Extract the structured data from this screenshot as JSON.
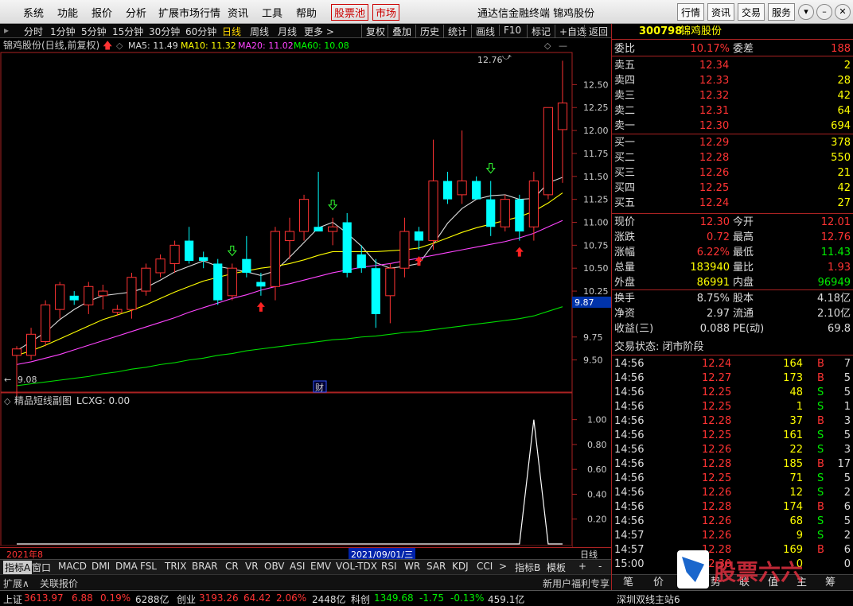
{
  "menubar": {
    "items": [
      "系统",
      "功能",
      "报价",
      "分析",
      "扩展市场行情",
      "资讯",
      "工具",
      "帮助"
    ],
    "highlight": [
      "股票池",
      "市场"
    ],
    "title": "通达信金融终端  锦鸡股份",
    "right_buttons": [
      "行情",
      "资讯",
      "交易",
      "服务"
    ]
  },
  "period": {
    "items": [
      "分时",
      "1分钟",
      "5分钟",
      "15分钟",
      "30分钟",
      "60分钟",
      "日线",
      "周线",
      "月线",
      "更多 >"
    ],
    "active": "日线",
    "tools": [
      "复权",
      "叠加",
      "历史",
      "统计",
      "画线",
      "F10",
      "标记",
      "+自选",
      "返回"
    ]
  },
  "main_chart": {
    "header": {
      "title": "锦鸡股份(日线,前复权)",
      "ma5": "MA5: 11.49",
      "ma10": "MA10: 11.32",
      "ma20": "MA20: 11.02",
      "ma60": "MA60: 10.08"
    },
    "high_label": "12.76",
    "low_label": "9.08",
    "last_tag": "9.87",
    "fin_mark": "财",
    "y_ticks": [
      "12.50",
      "12.25",
      "12.00",
      "11.75",
      "11.50",
      "11.25",
      "11.00",
      "10.75",
      "10.50",
      "10.25",
      "9.75",
      "9.50"
    ]
  },
  "indicator": {
    "title": "精品短线副图",
    "value": "LCXG: 0.00",
    "y_ticks": [
      "1.00",
      "0.80",
      "0.60",
      "0.40",
      "0.20"
    ]
  },
  "timeline": {
    "start": "2021年8",
    "cursor": "2021/09/01/三",
    "period_label": "日线"
  },
  "chart_data": [
    {
      "type": "candlestick",
      "title": "锦鸡股份(日线,前复权)",
      "ylim": [
        9.15,
        12.85
      ],
      "candles": [
        {
          "o": 9.55,
          "h": 9.65,
          "l": 9.1,
          "c": 9.62
        },
        {
          "o": 9.55,
          "h": 9.85,
          "l": 9.5,
          "c": 9.78
        },
        {
          "o": 9.7,
          "h": 10.15,
          "l": 9.65,
          "c": 10.1
        },
        {
          "o": 10.05,
          "h": 10.35,
          "l": 9.95,
          "c": 10.32
        },
        {
          "o": 10.2,
          "h": 10.25,
          "l": 10.1,
          "c": 10.15
        },
        {
          "o": 10.1,
          "h": 10.35,
          "l": 10.0,
          "c": 10.3
        },
        {
          "o": 10.2,
          "h": 10.32,
          "l": 10.05,
          "c": 10.25
        },
        {
          "o": 10.02,
          "h": 10.1,
          "l": 9.98,
          "c": 10.05
        },
        {
          "o": 10.05,
          "h": 10.45,
          "l": 9.95,
          "c": 10.4
        },
        {
          "o": 10.25,
          "h": 10.55,
          "l": 10.2,
          "c": 10.5
        },
        {
          "o": 10.45,
          "h": 10.65,
          "l": 10.4,
          "c": 10.6
        },
        {
          "o": 10.55,
          "h": 10.8,
          "l": 10.45,
          "c": 10.75
        },
        {
          "o": 10.8,
          "h": 10.95,
          "l": 10.55,
          "c": 10.58
        },
        {
          "o": 10.62,
          "h": 10.68,
          "l": 10.5,
          "c": 10.58
        },
        {
          "o": 10.55,
          "h": 10.6,
          "l": 10.1,
          "c": 10.15
        },
        {
          "o": 10.2,
          "h": 10.55,
          "l": 10.15,
          "c": 10.5
        },
        {
          "o": 10.6,
          "h": 10.85,
          "l": 10.4,
          "c": 10.45
        },
        {
          "o": 10.35,
          "h": 10.45,
          "l": 10.2,
          "c": 10.3
        },
        {
          "o": 10.3,
          "h": 10.95,
          "l": 10.15,
          "c": 10.9
        },
        {
          "o": 10.8,
          "h": 11.05,
          "l": 10.6,
          "c": 10.9
        },
        {
          "o": 10.9,
          "h": 11.3,
          "l": 10.8,
          "c": 11.25
        },
        {
          "o": 10.95,
          "h": 11.55,
          "l": 10.9,
          "c": 10.9
        },
        {
          "o": 10.9,
          "h": 11.05,
          "l": 10.75,
          "c": 10.95
        },
        {
          "o": 11.0,
          "h": 11.1,
          "l": 10.4,
          "c": 10.45
        },
        {
          "o": 10.65,
          "h": 10.75,
          "l": 10.45,
          "c": 10.5
        },
        {
          "o": 10.5,
          "h": 10.6,
          "l": 9.85,
          "c": 10.0
        },
        {
          "o": 10.2,
          "h": 10.55,
          "l": 9.9,
          "c": 10.5
        },
        {
          "o": 10.5,
          "h": 11.05,
          "l": 10.4,
          "c": 10.9
        },
        {
          "o": 10.9,
          "h": 10.95,
          "l": 10.7,
          "c": 10.8
        },
        {
          "o": 10.8,
          "h": 11.9,
          "l": 10.7,
          "c": 11.45
        },
        {
          "o": 11.45,
          "h": 11.55,
          "l": 11.2,
          "c": 11.25
        },
        {
          "o": 11.3,
          "h": 12.0,
          "l": 11.2,
          "c": 11.45
        },
        {
          "o": 11.45,
          "h": 11.5,
          "l": 11.25,
          "c": 11.25
        },
        {
          "o": 11.25,
          "h": 11.45,
          "l": 10.85,
          "c": 10.95
        },
        {
          "o": 10.95,
          "h": 11.3,
          "l": 10.9,
          "c": 11.25
        },
        {
          "o": 11.25,
          "h": 11.3,
          "l": 10.8,
          "c": 10.9
        },
        {
          "o": 10.95,
          "h": 11.55,
          "l": 10.8,
          "c": 11.45
        },
        {
          "o": 11.3,
          "h": 12.25,
          "l": 11.25,
          "c": 12.25
        },
        {
          "o": 12.01,
          "h": 12.76,
          "l": 11.43,
          "c": 12.3
        }
      ],
      "ma5": [
        9.6,
        9.7,
        9.8,
        9.94,
        10.05,
        10.14,
        10.2,
        10.22,
        10.24,
        10.29,
        10.37,
        10.46,
        10.52,
        10.58,
        10.52,
        10.49,
        10.46,
        10.42,
        10.47,
        10.62,
        10.78,
        10.94,
        11.0,
        10.88,
        10.74,
        10.56,
        10.5,
        10.52,
        10.55,
        10.76,
        10.99,
        11.15,
        11.25,
        11.29,
        11.3,
        11.25,
        11.26,
        11.43,
        11.49
      ],
      "ma10": [
        9.55,
        9.6,
        9.66,
        9.73,
        9.8,
        9.87,
        9.94,
        9.99,
        10.04,
        10.1,
        10.17,
        10.24,
        10.3,
        10.36,
        10.4,
        10.44,
        10.47,
        10.5,
        10.52,
        10.55,
        10.59,
        10.64,
        10.68,
        10.68,
        10.68,
        10.68,
        10.69,
        10.7,
        10.72,
        10.77,
        10.83,
        10.89,
        10.94,
        10.98,
        11.02,
        11.06,
        11.12,
        11.21,
        11.32
      ],
      "ma20": [
        9.45,
        9.48,
        9.52,
        9.56,
        9.61,
        9.66,
        9.71,
        9.76,
        9.81,
        9.86,
        9.91,
        9.96,
        10.02,
        10.07,
        10.12,
        10.17,
        10.21,
        10.26,
        10.3,
        10.33,
        10.37,
        10.41,
        10.45,
        10.48,
        10.51,
        10.53,
        10.55,
        10.58,
        10.61,
        10.64,
        10.67,
        10.7,
        10.73,
        10.76,
        10.79,
        10.83,
        10.88,
        10.95,
        11.02
      ],
      "ma60": [
        9.22,
        9.24,
        9.26,
        9.28,
        9.3,
        9.32,
        9.35,
        9.37,
        9.4,
        9.42,
        9.45,
        9.47,
        9.5,
        9.52,
        9.55,
        9.57,
        9.6,
        9.62,
        9.64,
        9.66,
        9.68,
        9.7,
        9.72,
        9.73,
        9.75,
        9.76,
        9.78,
        9.8,
        9.81,
        9.83,
        9.85,
        9.87,
        9.89,
        9.91,
        9.93,
        9.95,
        9.98,
        10.03,
        10.08
      ],
      "buy_signals": [
        17,
        28,
        35
      ],
      "sell_signals": [
        15,
        22,
        33
      ]
    },
    {
      "type": "line",
      "title": "精品短线副图",
      "ylim": [
        0,
        1.1
      ],
      "x": [
        0,
        1,
        2,
        3,
        4,
        5,
        6,
        7,
        8,
        9,
        10,
        11,
        12,
        13,
        14,
        15,
        16,
        17,
        18,
        19,
        20,
        21,
        22,
        23,
        24,
        25,
        26,
        27,
        28,
        29,
        30,
        31,
        32,
        33,
        34,
        35,
        36,
        37,
        38
      ],
      "values": [
        0,
        0,
        0,
        0,
        0,
        0,
        0,
        0,
        0,
        0,
        0,
        0,
        0,
        0,
        0,
        0,
        0,
        0,
        0,
        0,
        0,
        0,
        0,
        0,
        0,
        0,
        0,
        0,
        0,
        0,
        0,
        0,
        0,
        0,
        0,
        0,
        1,
        0,
        0
      ]
    }
  ],
  "quote": {
    "code": "300798",
    "name": "锦鸡股份",
    "weibi": {
      "label": "委比",
      "value": "10.17%",
      "label2": "委差",
      "value2": "188"
    },
    "asks": [
      [
        "卖五",
        "12.34",
        "2"
      ],
      [
        "卖四",
        "12.33",
        "28"
      ],
      [
        "卖三",
        "12.32",
        "42"
      ],
      [
        "卖二",
        "12.31",
        "64"
      ],
      [
        "卖一",
        "12.30",
        "694"
      ]
    ],
    "bids": [
      [
        "买一",
        "12.29",
        "378"
      ],
      [
        "买二",
        "12.28",
        "550"
      ],
      [
        "买三",
        "12.26",
        "21"
      ],
      [
        "买四",
        "12.25",
        "42"
      ],
      [
        "买五",
        "12.24",
        "27"
      ]
    ],
    "stats": [
      [
        "现价",
        "12.30",
        "今开",
        "12.01"
      ],
      [
        "涨跌",
        "0.72",
        "最高",
        "12.76"
      ],
      [
        "涨幅",
        "6.22%",
        "最低",
        "11.43"
      ],
      [
        "总量",
        "183940",
        "量比",
        "1.93"
      ],
      [
        "外盘",
        "86991",
        "内盘",
        "96949"
      ]
    ],
    "fund": [
      [
        "换手",
        "8.75%",
        "股本",
        "4.18亿"
      ],
      [
        "净资",
        "2.97",
        "流通",
        "2.10亿"
      ],
      [
        "收益(三)",
        "0.088",
        "PE(动)",
        "69.8"
      ]
    ],
    "status": "交易状态: 闭市阶段",
    "ticks": [
      [
        "14:56",
        "12.24",
        "164",
        "B",
        "7"
      ],
      [
        "14:56",
        "12.27",
        "173",
        "B",
        "5"
      ],
      [
        "14:56",
        "12.25",
        "48",
        "S",
        "5"
      ],
      [
        "14:56",
        "12.25",
        "1",
        "S",
        "1"
      ],
      [
        "14:56",
        "12.28",
        "37",
        "B",
        "3"
      ],
      [
        "14:56",
        "12.25",
        "161",
        "S",
        "5"
      ],
      [
        "14:56",
        "12.26",
        "22",
        "S",
        "3"
      ],
      [
        "14:56",
        "12.28",
        "185",
        "B",
        "17"
      ],
      [
        "14:56",
        "12.25",
        "71",
        "S",
        "5"
      ],
      [
        "14:56",
        "12.26",
        "12",
        "S",
        "2"
      ],
      [
        "14:56",
        "12.28",
        "174",
        "B",
        "6"
      ],
      [
        "14:56",
        "12.26",
        "68",
        "S",
        "5"
      ],
      [
        "14:57",
        "12.26",
        "9",
        "S",
        "2"
      ],
      [
        "14:57",
        "12.28",
        "169",
        "B",
        "6"
      ],
      [
        "15:00",
        "12.30",
        "0",
        "",
        "0"
      ]
    ],
    "tabs": [
      "笔",
      "价",
      "细",
      "势",
      "联",
      "值",
      "主",
      "筹"
    ],
    "watermark": "股票六六"
  },
  "bottom_tabs": [
    "指标A",
    "窗口",
    "MACD",
    "DMI",
    "DMA",
    "FSL",
    "TRIX",
    "BRAR",
    "CR",
    "VR",
    "OBV",
    "ASI",
    "EMV",
    "VOL-TDX",
    "RSI",
    "WR",
    "SAR",
    "KDJ",
    "CCI",
    ">",
    "指标B",
    "模板",
    "+",
    "-"
  ],
  "ext": {
    "left": [
      "扩展∧",
      "关联报价"
    ],
    "right": "新用户福利专享"
  },
  "statusbar": [
    {
      "name": "上证",
      "v": "3613.97",
      "c": "6.88",
      "p": "0.19%",
      "a": "6288亿"
    },
    {
      "name": "创业",
      "v": "3193.26",
      "c": "64.42",
      "p": "2.06%",
      "a": "2448亿"
    },
    {
      "name": "科创",
      "v": "1349.68",
      "c": "-1.75",
      "p": "-0.13%",
      "a": "459.1亿"
    }
  ],
  "server": "深圳双线主站6"
}
